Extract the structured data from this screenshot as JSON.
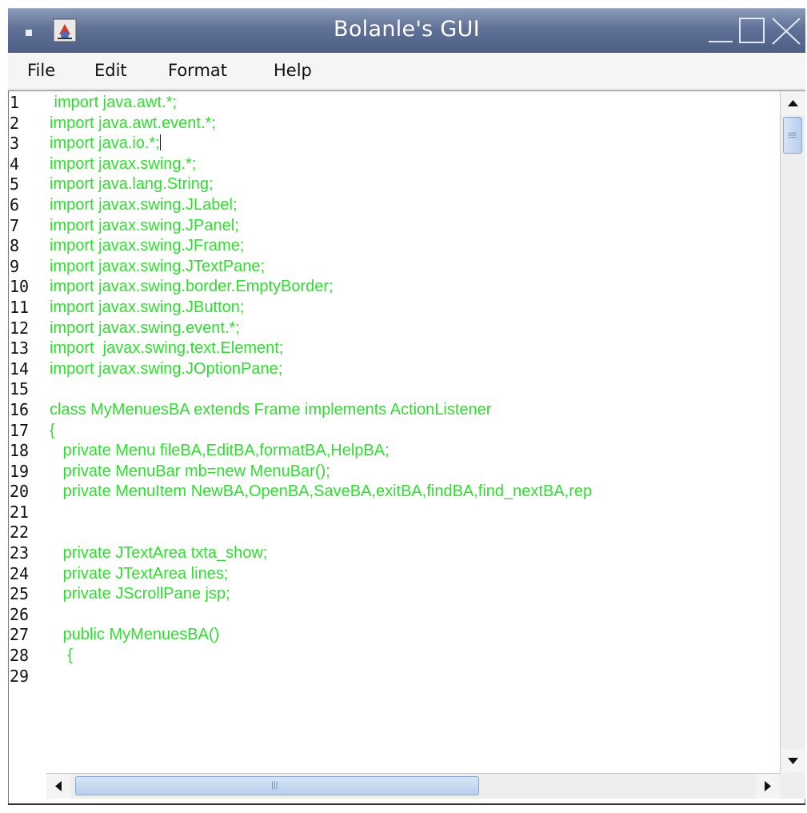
{
  "window": {
    "title": "Bolanle's GUI"
  },
  "menubar": {
    "items": [
      {
        "label": "File"
      },
      {
        "label": "Edit"
      },
      {
        "label": "Format"
      },
      {
        "label": "Help"
      }
    ]
  },
  "editor": {
    "line_numbers": [
      "1",
      "2",
      "3",
      "4",
      "5",
      "6",
      "7",
      "8",
      "9",
      "10",
      "11",
      "12",
      "13",
      "14",
      "15",
      "16",
      "17",
      "18",
      "19",
      "20",
      "21",
      "22",
      "23",
      "24",
      "25",
      "26",
      "27",
      "28",
      "29"
    ],
    "lines": [
      " import java.awt.*;",
      "import java.awt.event.*;",
      "import java.io.*;",
      "import javax.swing.*;",
      "import java.lang.String;",
      "import javax.swing.JLabel;",
      "import javax.swing.JPanel;",
      "import javax.swing.JFrame;",
      "import javax.swing.JTextPane;",
      "import javax.swing.border.EmptyBorder;",
      "import javax.swing.JButton;",
      "import javax.swing.event.*;",
      "import  javax.swing.text.Element;",
      "import javax.swing.JOptionPane;",
      "",
      "class MyMenuesBA extends Frame implements ActionListener",
      "{",
      "   private Menu fileBA,EditBA,formatBA,HelpBA;",
      "   private MenuBar mb=new MenuBar();",
      "   private MenuItem NewBA,OpenBA,SaveBA,exitBA,findBA,find_nextBA,rep",
      "",
      "",
      "   private JTextArea txta_show;",
      "   private JTextArea lines;",
      "   private JScrollPane jsp;",
      "",
      "   public MyMenuesBA()",
      "    {",
      ""
    ],
    "text_color": "#2ee02e"
  },
  "colors": {
    "titlebar": "#5f7196",
    "scroll_thumb": "#c8daf2"
  }
}
